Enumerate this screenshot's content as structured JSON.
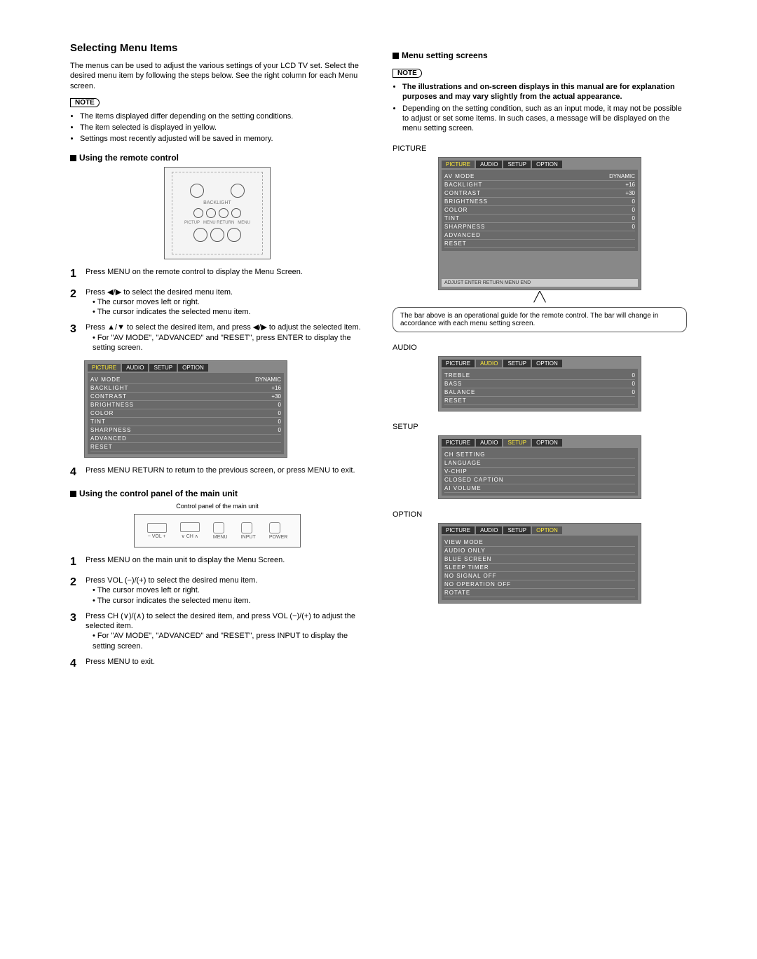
{
  "left": {
    "title": "Selecting Menu Items",
    "intro": "The menus can be used to adjust the various settings of your LCD TV set. Select the desired menu item by following the steps below. See the right column for each Menu screen.",
    "noteLabel": "NOTE",
    "notes": [
      "The items displayed differ depending on the setting conditions.",
      "The item selected is displayed in yellow.",
      "Settings most recently adjusted will be saved in memory."
    ],
    "remoteHeading": "Using the remote control",
    "remoteSteps": [
      {
        "main": "Press MENU on the remote control to display the Menu Screen."
      },
      {
        "main": "Press ◀/▶ to select the desired menu item.",
        "subs": [
          "The cursor moves left or right.",
          "The cursor indicates the selected menu item."
        ]
      },
      {
        "main": "Press ▲/▼ to select the desired item, and press ◀/▶ to adjust the selected item.",
        "subs": [
          "For \"AV MODE\", \"ADVANCED\" and \"RESET\", press ENTER to display the setting screen."
        ]
      },
      {
        "main": "Press MENU RETURN to return to the previous screen, or press MENU to exit."
      }
    ],
    "panelHeading": "Using the control panel of the main unit",
    "panelCaption": "Control panel of the main unit",
    "panelLabels": [
      "− VOL +",
      "∨ CH ∧",
      "MENU",
      "INPUT",
      "POWER"
    ],
    "panelSteps": [
      {
        "main": "Press MENU on the main unit to display the Menu Screen."
      },
      {
        "main": "Press VOL (−)/(+) to select the desired menu item.",
        "subs": [
          "The cursor moves left or right.",
          "The cursor indicates the selected menu item."
        ]
      },
      {
        "main": "Press CH (∨)/(∧) to select the desired item, and press VOL (−)/(+) to adjust the selected item.",
        "subs": [
          "For \"AV MODE\", \"ADVANCED\" and \"RESET\", press INPUT to display the setting screen."
        ]
      },
      {
        "main": "Press MENU to exit."
      }
    ],
    "pictureMenu": {
      "tabs": [
        "PICTURE",
        "AUDIO",
        "SETUP",
        "OPTION"
      ],
      "rows": [
        [
          "AV MODE",
          "DYNAMIC"
        ],
        [
          "BACKLIGHT",
          "+16"
        ],
        [
          "CONTRAST",
          "+30"
        ],
        [
          "BRIGHTNESS",
          "0"
        ],
        [
          "COLOR",
          "0"
        ],
        [
          "TINT",
          "0"
        ],
        [
          "SHARPNESS",
          "0"
        ],
        [
          "ADVANCED",
          ""
        ],
        [
          "RESET",
          ""
        ]
      ]
    }
  },
  "right": {
    "title": "Menu setting screens",
    "noteLabel": "NOTE",
    "notes": [
      "The illustrations and on-screen displays in this manual are for explanation purposes and may vary slightly from the actual appearance.",
      "Depending on the setting condition, such as an input mode, it may not be possible to adjust or set some items. In such cases, a message will be displayed on the menu setting screen."
    ],
    "callout": "The bar above is an operational guide for the remote control. The bar will change in accordance with each menu setting screen.",
    "opbar": "ADJUST  ENTER  RETURN  MENU  END",
    "sections": {
      "picture": {
        "label": "PICTURE",
        "tabs": [
          "PICTURE",
          "AUDIO",
          "SETUP",
          "OPTION"
        ],
        "rows": [
          [
            "AV MODE",
            "DYNAMIC"
          ],
          [
            "BACKLIGHT",
            "+16"
          ],
          [
            "CONTRAST",
            "+30"
          ],
          [
            "BRIGHTNESS",
            "0"
          ],
          [
            "COLOR",
            "0"
          ],
          [
            "TINT",
            "0"
          ],
          [
            "SHARPNESS",
            "0"
          ],
          [
            "ADVANCED",
            ""
          ],
          [
            "RESET",
            ""
          ]
        ]
      },
      "audio": {
        "label": "AUDIO",
        "tabs": [
          "PICTURE",
          "AUDIO",
          "SETUP",
          "OPTION"
        ],
        "rows": [
          [
            "TREBLE",
            "0"
          ],
          [
            "BASS",
            "0"
          ],
          [
            "BALANCE",
            "0"
          ],
          [
            "RESET",
            ""
          ]
        ]
      },
      "setup": {
        "label": "SETUP",
        "tabs": [
          "PICTURE",
          "AUDIO",
          "SETUP",
          "OPTION"
        ],
        "rows": [
          [
            "CH SETTING",
            ""
          ],
          [
            "LANGUAGE",
            ""
          ],
          [
            "V-CHIP",
            ""
          ],
          [
            "CLOSED CAPTION",
            ""
          ],
          [
            "AI VOLUME",
            ""
          ]
        ]
      },
      "option": {
        "label": "OPTION",
        "tabs": [
          "PICTURE",
          "AUDIO",
          "SETUP",
          "OPTION"
        ],
        "rows": [
          [
            "VIEW MODE",
            ""
          ],
          [
            "AUDIO ONLY",
            ""
          ],
          [
            "BLUE SCREEN",
            ""
          ],
          [
            "SLEEP TIMER",
            ""
          ],
          [
            "NO SIGNAL OFF",
            ""
          ],
          [
            "NO OPERATION OFF",
            ""
          ],
          [
            "ROTATE",
            ""
          ]
        ]
      }
    }
  }
}
